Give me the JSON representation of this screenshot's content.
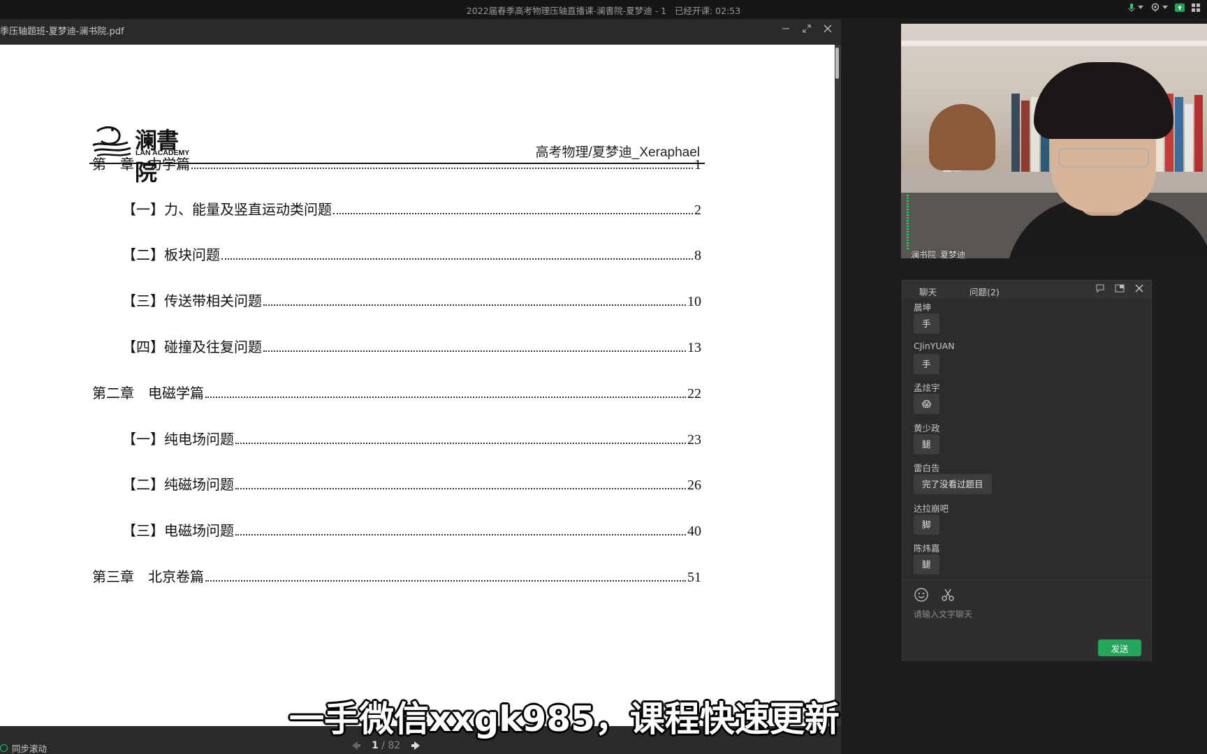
{
  "window": {
    "title": "2022届春季高考物理压轴直播课-澜書院-夏梦迪 - 1",
    "elapsed_label": "已经开课:",
    "elapsed": "02:53"
  },
  "pdf": {
    "filename": "季压轴题班-夏梦迪-澜书院.pdf",
    "logo_cn": "澜書院",
    "logo_en": "LAN ACADEMY",
    "header_right": "高考物理/夏梦迪_Xeraphael",
    "toc": [
      {
        "title": "第一章　力学篇",
        "page": "1"
      },
      {
        "title": "【一】力、能量及竖直运动类问题",
        "page": "2"
      },
      {
        "title": "【二】板块问题",
        "page": "8"
      },
      {
        "title": "【三】传送带相关问题",
        "page": "10"
      },
      {
        "title": "【四】碰撞及往复问题",
        "page": "13"
      },
      {
        "title": "第二章　电磁学篇",
        "page": "22"
      },
      {
        "title": "【一】纯电场问题",
        "page": "23"
      },
      {
        "title": "【二】纯磁场问题",
        "page": "26"
      },
      {
        "title": "【三】电磁场问题",
        "page": "40"
      },
      {
        "title": "第三章　北京卷篇",
        "page": "51"
      }
    ],
    "sync_label": "同步滚动",
    "page_current": "1",
    "page_total": "/ 82"
  },
  "subtitle": "一手微信xxgk985，课程快速更新",
  "video": {
    "name_tag": "澜书院_夏梦迪"
  },
  "chat": {
    "tab_chat": "聊天",
    "tab_questions": "问题(2)",
    "messages": [
      {
        "user": "晨坤",
        "text": "手"
      },
      {
        "user": "CJinYUAN",
        "text": "手"
      },
      {
        "user": "孟炫宇",
        "text": "😱"
      },
      {
        "user": "黄少政",
        "text": "腿"
      },
      {
        "user": "雷白告",
        "text": "完了没看过题目"
      },
      {
        "user": "达拉崩吧",
        "text": "脚"
      },
      {
        "user": "陈炜嘉",
        "text": "腿"
      }
    ],
    "input_placeholder": "请输入文字聊天",
    "send_label": "发送"
  },
  "colors": {
    "accent_green": "#23a55a",
    "page_bg": "#ffffff",
    "app_bg": "#1d1d1d"
  }
}
